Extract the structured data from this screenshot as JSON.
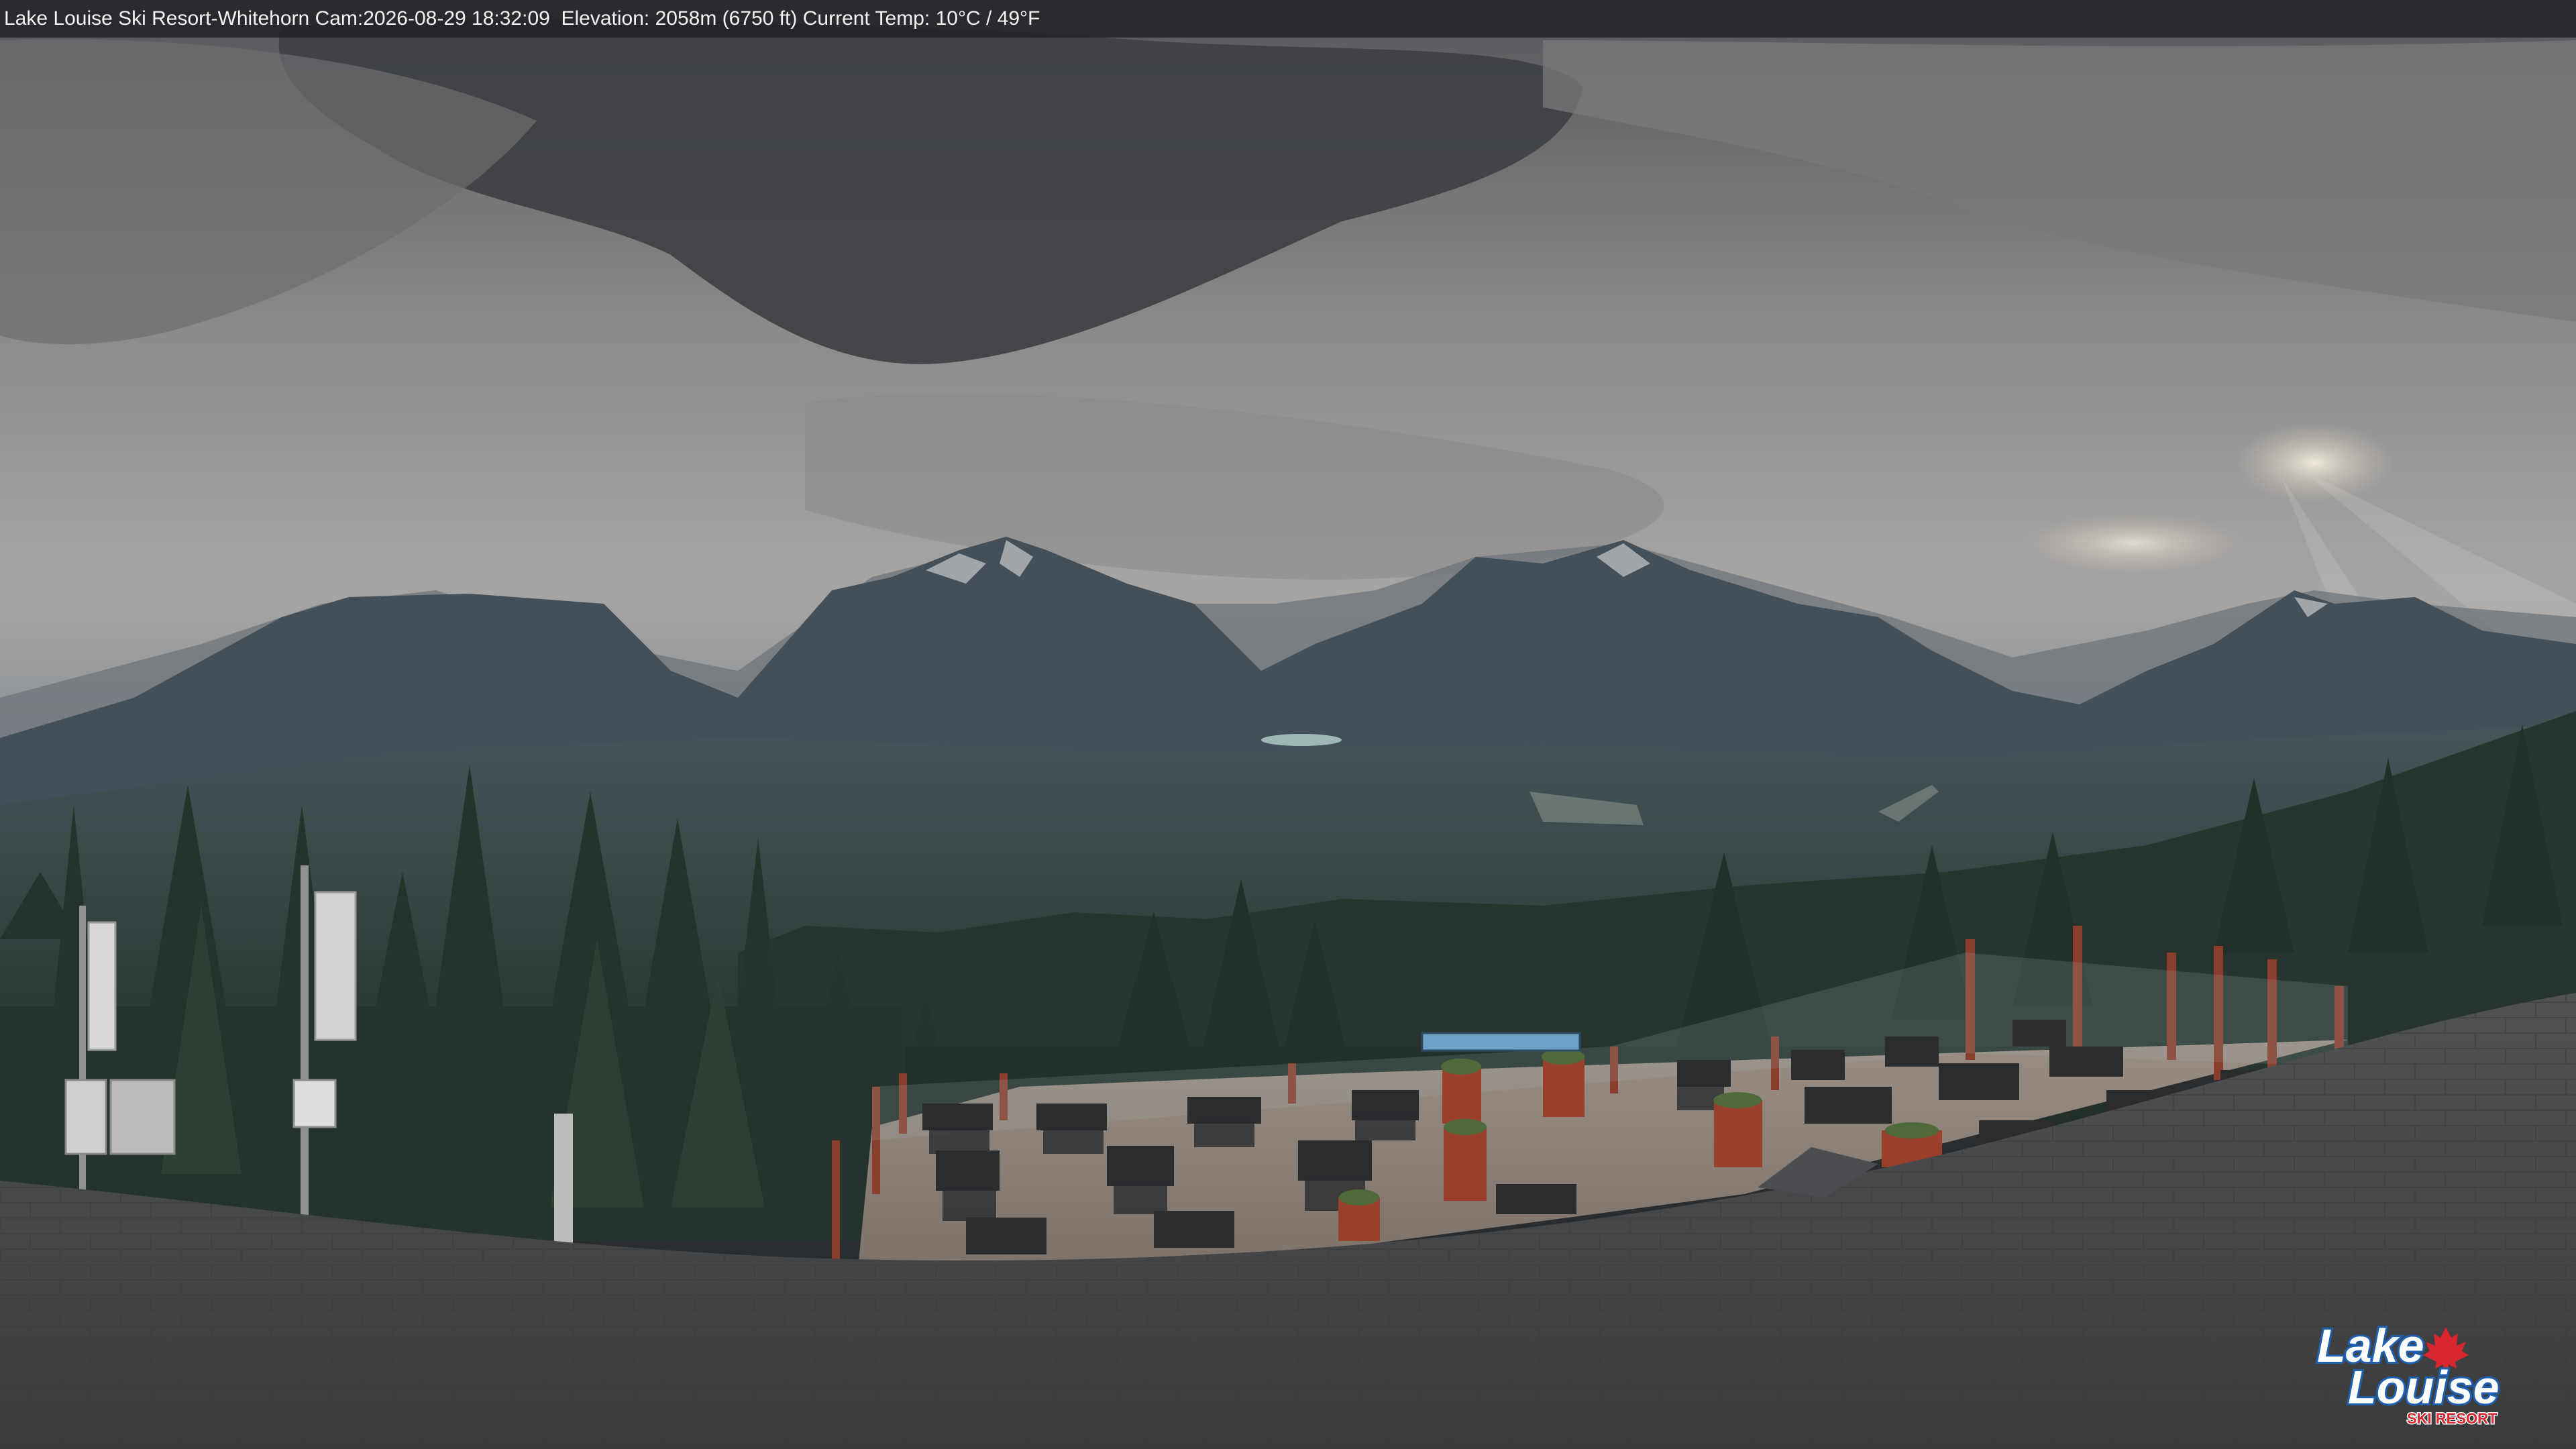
{
  "camera": {
    "resort": "Lake Louise Ski Resort",
    "camera_name": "Whitehorn Cam",
    "separator_dash": " - ",
    "separator_colon": " : ",
    "timestamp": "2026-08-29 18:32:09",
    "elevation_label": "Elevation:",
    "elevation_value": "2058m (6750 ft)",
    "temp_label": "Current Temp:",
    "temp_value": "10°C / 49°F"
  },
  "logo": {
    "line1": "Lake",
    "line2": "Louise",
    "line3": "SKI RESORT",
    "brand_blue": "#1e5fb0",
    "brand_red": "#d7262e"
  },
  "colors": {
    "sky_light": "#a9a7a6",
    "cloud_dark": "#3c3e41",
    "mountain": "#3f4a52",
    "forest": "#27362f",
    "roof": "#47484a",
    "deck": "#8c8178"
  }
}
